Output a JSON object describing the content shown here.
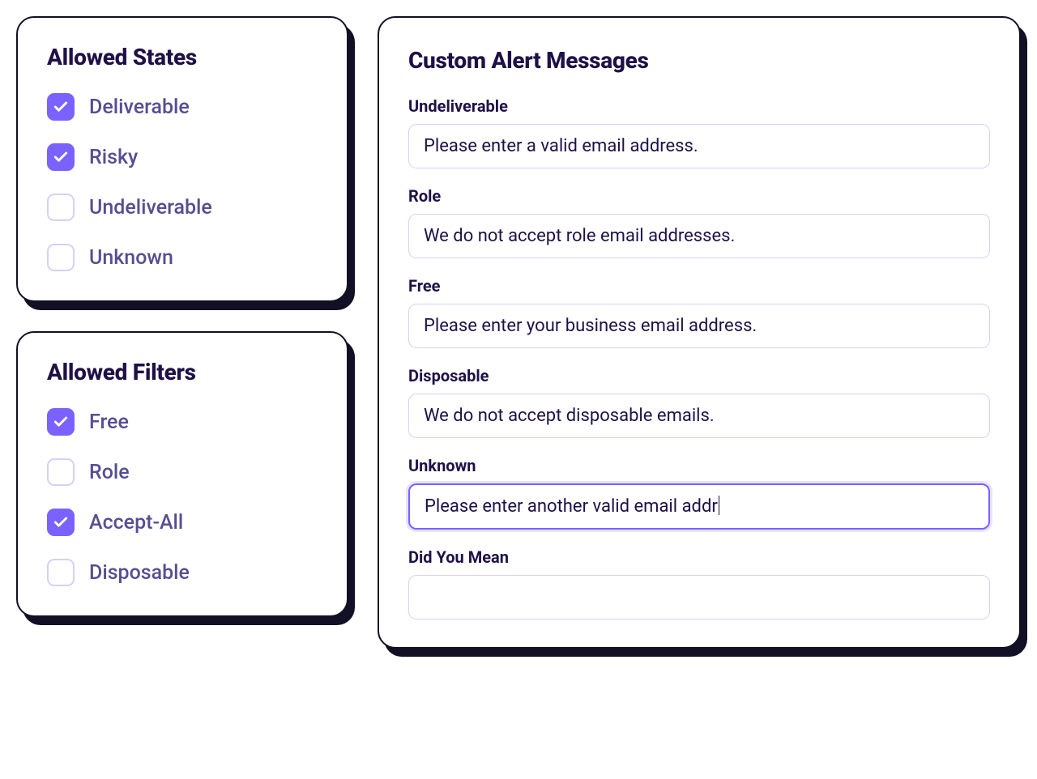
{
  "allowedStates": {
    "title": "Allowed States",
    "items": [
      {
        "label": "Deliverable",
        "checked": true
      },
      {
        "label": "Risky",
        "checked": true
      },
      {
        "label": "Undeliverable",
        "checked": false
      },
      {
        "label": "Unknown",
        "checked": false
      }
    ]
  },
  "allowedFilters": {
    "title": "Allowed Filters",
    "items": [
      {
        "label": "Free",
        "checked": true
      },
      {
        "label": "Role",
        "checked": false
      },
      {
        "label": "Accept-All",
        "checked": true
      },
      {
        "label": "Disposable",
        "checked": false
      }
    ]
  },
  "customAlerts": {
    "title": "Custom Alert Messages",
    "fields": [
      {
        "label": "Undeliverable",
        "value": "Please enter a valid email address.",
        "focused": false
      },
      {
        "label": "Role",
        "value": "We do not accept role email addresses.",
        "focused": false
      },
      {
        "label": "Free",
        "value": "Please enter your business email address.",
        "focused": false
      },
      {
        "label": "Disposable",
        "value": "We do not accept disposable emails.",
        "focused": false
      },
      {
        "label": "Unknown",
        "value": "Please enter another valid email addr",
        "focused": true
      },
      {
        "label": "Did You Mean",
        "value": "",
        "focused": false
      }
    ]
  }
}
